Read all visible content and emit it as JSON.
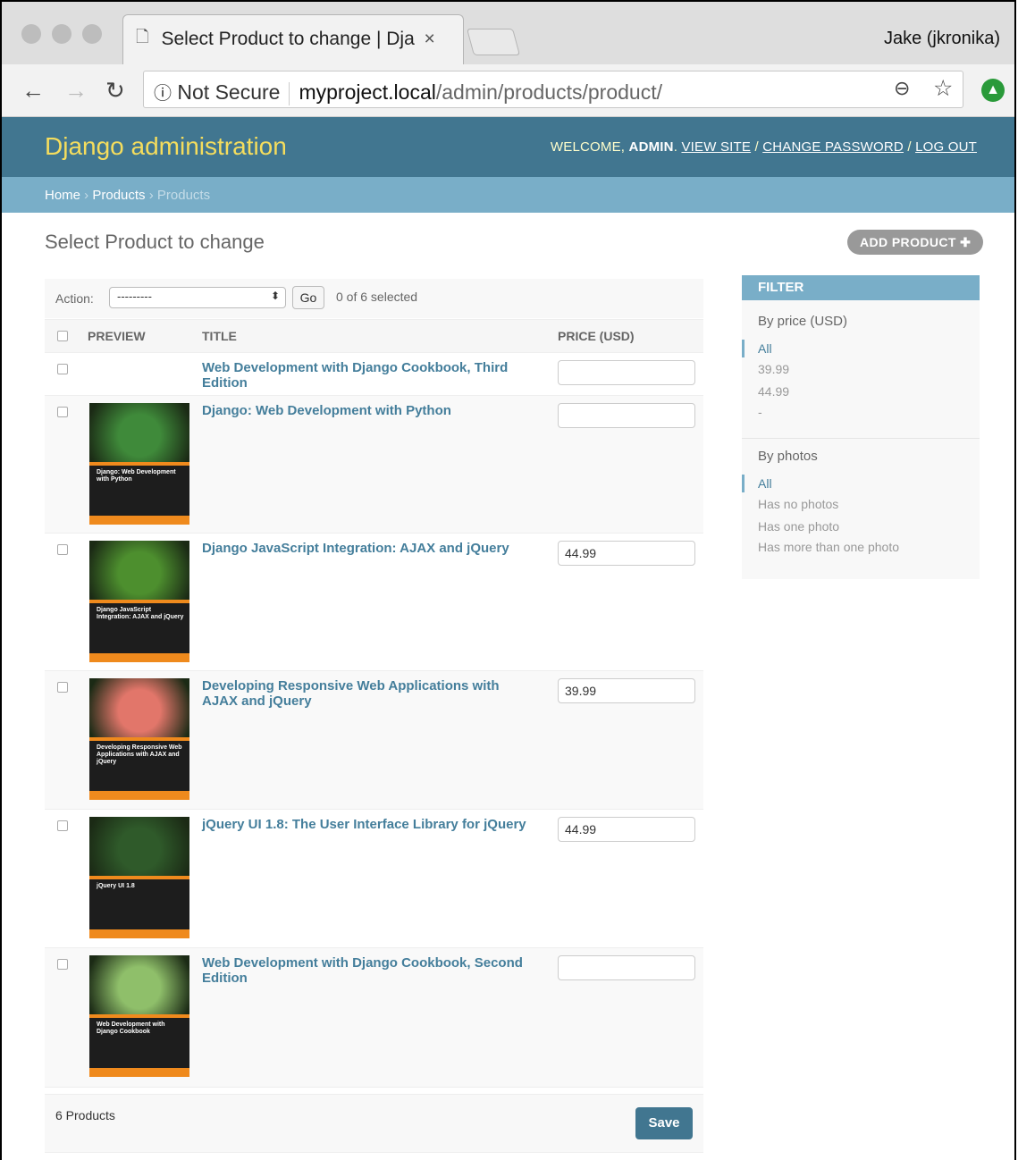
{
  "browser": {
    "tab_title": "Select Product to change | Dja",
    "user": "Jake (jkronika)",
    "security": "Not Secure",
    "url_host": "myproject.local",
    "url_path": "/admin/products/product/"
  },
  "header": {
    "brand": "Django administration",
    "welcome": "WELCOME,",
    "username": "ADMIN",
    "view_site": "VIEW SITE",
    "change_password": "CHANGE PASSWORD",
    "logout": "LOG OUT"
  },
  "breadcrumbs": {
    "home": "Home",
    "app": "Products",
    "current": "Products"
  },
  "page": {
    "title": "Select Product to change",
    "add_button": "ADD PRODUCT"
  },
  "actions": {
    "label": "Action:",
    "selected_option": "---------",
    "go": "Go",
    "selection": "0 of 6 selected"
  },
  "table": {
    "columns": [
      "PREVIEW",
      "TITLE",
      "PRICE (USD)"
    ],
    "rows": [
      {
        "title": "Web Development with Django Cookbook, Third Edition",
        "price": "",
        "cover_title": "",
        "cover_color": ""
      },
      {
        "title": "Django: Web Development with Python",
        "price": "",
        "cover_title": "Django: Web Development with Python",
        "cover_color": "#3f8a3a"
      },
      {
        "title": "Django JavaScript Integration: AJAX and jQuery",
        "price": "44.99",
        "cover_title": "Django JavaScript Integration: AJAX and jQuery",
        "cover_color": "#4d8f2e"
      },
      {
        "title": "Developing Responsive Web Applications with AJAX and jQuery",
        "price": "39.99",
        "cover_title": "Developing Responsive Web Applications with AJAX and jQuery",
        "cover_color": "#e2766a"
      },
      {
        "title": "jQuery UI 1.8: The User Interface Library for jQuery",
        "price": "44.99",
        "cover_title": "jQuery UI 1.8",
        "cover_color": "#2f5a2a"
      },
      {
        "title": "Web Development with Django Cookbook, Second Edition",
        "price": "",
        "cover_title": "Web Development with Django Cookbook",
        "cover_color": "#8fbf6a"
      }
    ]
  },
  "footer": {
    "count": "6 Products",
    "save": "Save"
  },
  "filter": {
    "title": "FILTER",
    "groups": [
      {
        "heading": "By price (USD)",
        "items": [
          "All",
          "39.99",
          "44.99",
          "-"
        ]
      },
      {
        "heading": "By photos",
        "items": [
          "All",
          "Has no photos",
          "Has one photo",
          "Has more than one photo"
        ]
      }
    ]
  },
  "colors": {
    "header_bg": "#417690",
    "breadcrumb_bg": "#79aec8",
    "brand_yellow": "#f5dd5d",
    "link": "#447e9b"
  }
}
